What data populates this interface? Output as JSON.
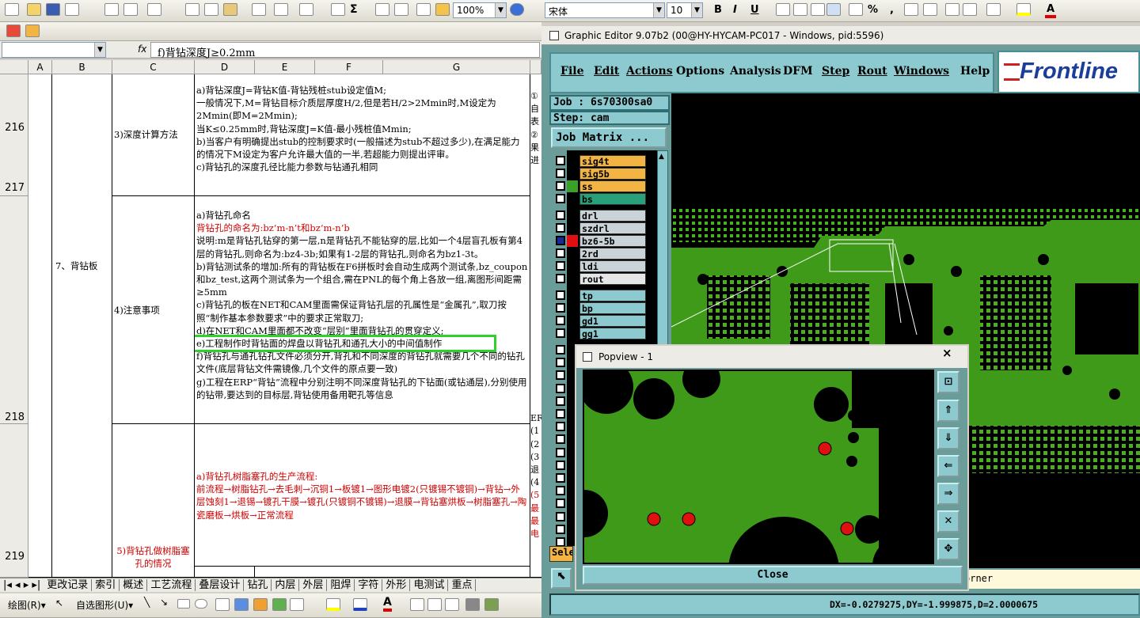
{
  "excel": {
    "toolbar_font": "宋体",
    "toolbar_size": "10",
    "toolbar_zoom": "100%",
    "formula_fx": "fx",
    "formula_text": "f)背钻深度J≥0.2mm",
    "columns": [
      "A",
      "B",
      "C",
      "D",
      "E",
      "F",
      "G"
    ],
    "rows": {
      "r216": "216",
      "r217": "217",
      "r218": "218",
      "r219": "219"
    },
    "b_label": "7、背钻板",
    "c216": "3)深度计算方法",
    "c218": "4)注意事项",
    "c219": "5)背钻孔做树脂塞孔的情况",
    "g216": [
      "a)背钻深度J=背钻K值-背钻残桩stub设定值M;",
      "一般情况下,M=背钻目标介质层厚度H/2,但是若H/2>2Mmin时,M设定为2Mmin(即M=2Mmin);",
      "当K≤0.25mm时,背钻深度J=K值-最小残桩值Mmin;",
      "b)当客户有明确提出stub的控制要求时(一般描述为stub不超过多少),在满足能力的情况下M设定为客户允许最大值的一半,若超能力则提出评审。",
      "c)背钻孔的深度孔径比能力参数与钻通孔相同"
    ],
    "g218_a": "a)背钻孔命名",
    "g218_red": "背钻孔的命名为:bz‘m-n’t和bz‘m-n’b",
    "g218_rest": [
      "说明:m是背钻孔钻穿的第一层,n是背钻孔不能钻穿的层,比如一个4层盲孔板有第4层的背钻孔,则命名为:bz4-3b;如果有1-2层的背钻孔,则命名为bz1-3t。",
      "b)背钻测试条的增加:所有的背钻板在F6拼板时会自动生成两个测试条,bz_coupon和bz_test,这两个测试条为一个组合,需在PNL的每个角上各放一组,离图形间距需≥5mm",
      "c)背钻孔的板在NET和CAM里面需保证背钻孔层的孔属性是“金属孔”,取刀按照“制作基本参数要求”中的要求正常取刀;",
      "d)在NET和CAM里面都不改变“层别”里面背钻孔的贯穿定义;"
    ],
    "g218_e": "e)工程制作时背钻面的焊盘以背钻孔和通孔大小的中间值制作",
    "g218_tail": [
      "f)背钻孔与通孔钻孔文件必须分开,背孔和不同深度的背钻孔就需要几个不同的钻孔文件(底层背钻文件需镜像,几个文件的原点要一致)",
      "g)工程在ERP“背钻”流程中分别注明不同深度背钻孔的下钻面(或钻通层),分别使用的钻带,要达到的目标层,背钻使用备用靶孔等信息"
    ],
    "g219": [
      "a)背钻孔树脂塞孔的生产流程:",
      "前流程→树脂钻孔→去毛刺→沉铜1→板镀1→图形电镀2(只镀锡不镀铜)→背钻→外层蚀刻1→退锡→镀孔干膜→镀孔(只镀铜不镀锡)→退膜→背钻塞烘板→树脂塞孔→陶瓷磨板→烘板→正常流程"
    ],
    "h216": [
      "①",
      "自",
      "表",
      "②",
      "果",
      "进"
    ],
    "h219": [
      "ERP",
      "(1",
      "(2",
      "(3",
      "退",
      "(4",
      "(5",
      "最",
      "最",
      "电"
    ],
    "sheet_tabs": [
      "更改记录",
      "索引",
      "概述",
      "工艺流程",
      "叠层设计",
      "钻孔",
      "内层",
      "外层",
      "阻焊",
      "字符",
      "外形",
      "电测试",
      "重点"
    ],
    "draw_bar": {
      "draw": "绘图(R)▾",
      "autoshapes": "自选图形(U)▾"
    }
  },
  "frontline": {
    "title": "Graphic Editor 9.07b2 (00@HY-HYCAM-PC017 - Windows, pid:5596)",
    "menu": [
      "File",
      "Edit",
      "Actions",
      "Options",
      "Analysis",
      "DFM",
      "Step",
      "Rout",
      "Windows",
      "Help"
    ],
    "logo": "Frontline",
    "job": "Job : 6s70300sa0",
    "step": "Step: cam",
    "job_matrix": "Job Matrix ...",
    "layers": [
      {
        "name": "sig4t",
        "color": "#f2b544"
      },
      {
        "name": "sig5b",
        "color": "#f2b544"
      },
      {
        "name": "ss",
        "color": "#f2b544"
      },
      {
        "name": "bs",
        "color": "#2aa07a"
      },
      {
        "name": "drl",
        "color": "#c9d3d8"
      },
      {
        "name": "szdrl",
        "color": "#c9d3d8"
      },
      {
        "name": "bz6-5b",
        "color": "#c9d3d8"
      },
      {
        "name": "2rd",
        "color": "#c9d3d8"
      },
      {
        "name": "ldi",
        "color": "#c9d3d8"
      },
      {
        "name": "rout",
        "color": "#e6e6e6"
      },
      {
        "name": "tp",
        "color": "#8ccad0"
      },
      {
        "name": "bp",
        "color": "#8ccad0"
      },
      {
        "name": "gd1",
        "color": "#8ccad0"
      },
      {
        "name": "gg1",
        "color": "#8ccad0"
      }
    ],
    "sel_label": "Sele",
    "popview_title": "Popview - 1",
    "close_label": "Close",
    "status_hint": "orner",
    "coords": "DX=-0.0279275,DY=-1.999875,D=2.0000675"
  }
}
